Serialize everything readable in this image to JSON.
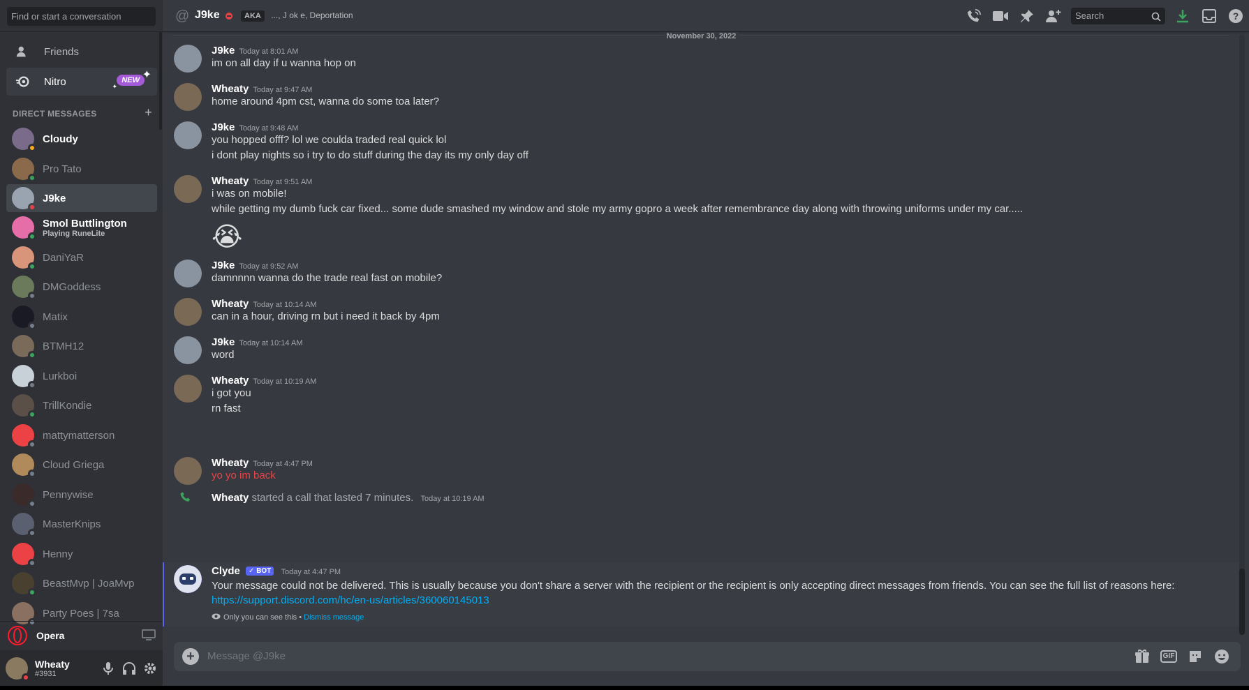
{
  "sidebar": {
    "search_placeholder": "Find or start a conversation",
    "nav": {
      "friends_label": "Friends",
      "nitro_label": "Nitro",
      "nitro_badge": "NEW"
    },
    "dm_header": "DIRECT MESSAGES",
    "dms": [
      {
        "name": "Cloudy",
        "status": "idle",
        "bright": true,
        "color": "#7a6b8a"
      },
      {
        "name": "Pro Tato",
        "status": "online",
        "color": "#8a6a4a"
      },
      {
        "name": "J9ke",
        "status": "dnd",
        "active": true,
        "color": "#9aa3b0"
      },
      {
        "name": "Smol Buttlington",
        "sub": "Playing RuneLite",
        "status": "online",
        "bright": true,
        "color": "#e66ea8"
      },
      {
        "name": "DaniYaR",
        "status": "online",
        "color": "#d9957a"
      },
      {
        "name": "DMGoddess",
        "status": "offline",
        "color": "#6a7a5a"
      },
      {
        "name": "Matix",
        "status": "offline",
        "color": "#1a1a24"
      },
      {
        "name": "BTMH12",
        "status": "online",
        "color": "#7a6a5a"
      },
      {
        "name": "Lurkboi",
        "status": "offline",
        "color": "#c8d0d8"
      },
      {
        "name": "TrillKondie",
        "status": "online",
        "color": "#5a5048"
      },
      {
        "name": "mattymatterson",
        "status": "offline",
        "color": "#ed4245"
      },
      {
        "name": "Cloud Griega",
        "status": "offline",
        "color": "#b08a5a"
      },
      {
        "name": "Pennywise",
        "status": "offline",
        "color": "#3a2a2a"
      },
      {
        "name": "MasterKnips",
        "status": "offline",
        "color": "#5a6070"
      },
      {
        "name": "Henny",
        "status": "offline",
        "color": "#ed4245"
      },
      {
        "name": "BeastMvp | JoaMvp",
        "status": "online",
        "color": "#4a4030"
      },
      {
        "name": "Party Poes | 7sa",
        "status": "offline",
        "color": "#8a7060"
      }
    ],
    "opera_label": "Opera",
    "user": {
      "name": "Wheaty",
      "tag": "#3931"
    }
  },
  "header": {
    "channel": "J9ke",
    "aka_label": "AKA",
    "aka_names": "..., J ok e, Deportation",
    "search_placeholder": "Search"
  },
  "chat": {
    "date": "November 30, 2022",
    "messages": [
      {
        "author": "J9ke",
        "time": "Today at 8:01 AM",
        "lines": [
          "im on all day if u wanna hop on"
        ]
      },
      {
        "author": "Wheaty",
        "time": "Today at 9:47 AM",
        "lines": [
          "home around 4pm cst, wanna do some toa later?"
        ]
      },
      {
        "author": "J9ke",
        "time": "Today at 9:48 AM",
        "lines": [
          "you hopped offf? lol we coulda traded real quick lol",
          "i dont play nights so i try to do stuff during the day its my only day off"
        ]
      },
      {
        "author": "Wheaty",
        "time": "Today at 9:51 AM",
        "lines": [
          "i was on mobile!",
          "while getting my dumb fuck car fixed... some dude smashed my window and stole my army gopro a week after remembrance day along with throwing uniforms under my car....."
        ],
        "emoji": "😭"
      },
      {
        "author": "J9ke",
        "time": "Today at 9:52 AM",
        "lines": [
          "damnnnn wanna do the trade real fast on mobile?"
        ]
      },
      {
        "author": "Wheaty",
        "time": "Today at 10:14 AM",
        "lines": [
          "can in a hour, driving rn but i need it back by 4pm"
        ]
      },
      {
        "author": "J9ke",
        "time": "Today at 10:14 AM",
        "lines": [
          "word"
        ]
      },
      {
        "author": "Wheaty",
        "time": "Today at 10:19 AM",
        "lines": [
          "i got you",
          "rn fast"
        ]
      },
      {
        "author": "Wheaty",
        "time": "Today at 4:47 PM",
        "lines": [
          "yo yo im back"
        ]
      }
    ],
    "call": {
      "author": "Wheaty",
      "text": "started a call that lasted 7 minutes.",
      "time": "Today at 10:19 AM"
    },
    "clyde": {
      "author": "Clyde",
      "badge": "BOT",
      "time": "Today at 4:47 PM",
      "text": "Your message could not be delivered. This is usually because you don't share a server with the recipient or the recipient is only accepting direct messages from friends. You can see the full list of reasons here:",
      "link": "https://support.discord.com/hc/en-us/articles/360060145013",
      "ephemeral": "Only you can see this •",
      "dismiss": "Dismiss message"
    }
  },
  "composer": {
    "placeholder": "Message @J9ke",
    "gif_label": "GIF"
  },
  "colors": {
    "accent": "#5865f2",
    "link": "#00aff4",
    "error": "#ed4245",
    "online": "#3ba55d"
  }
}
